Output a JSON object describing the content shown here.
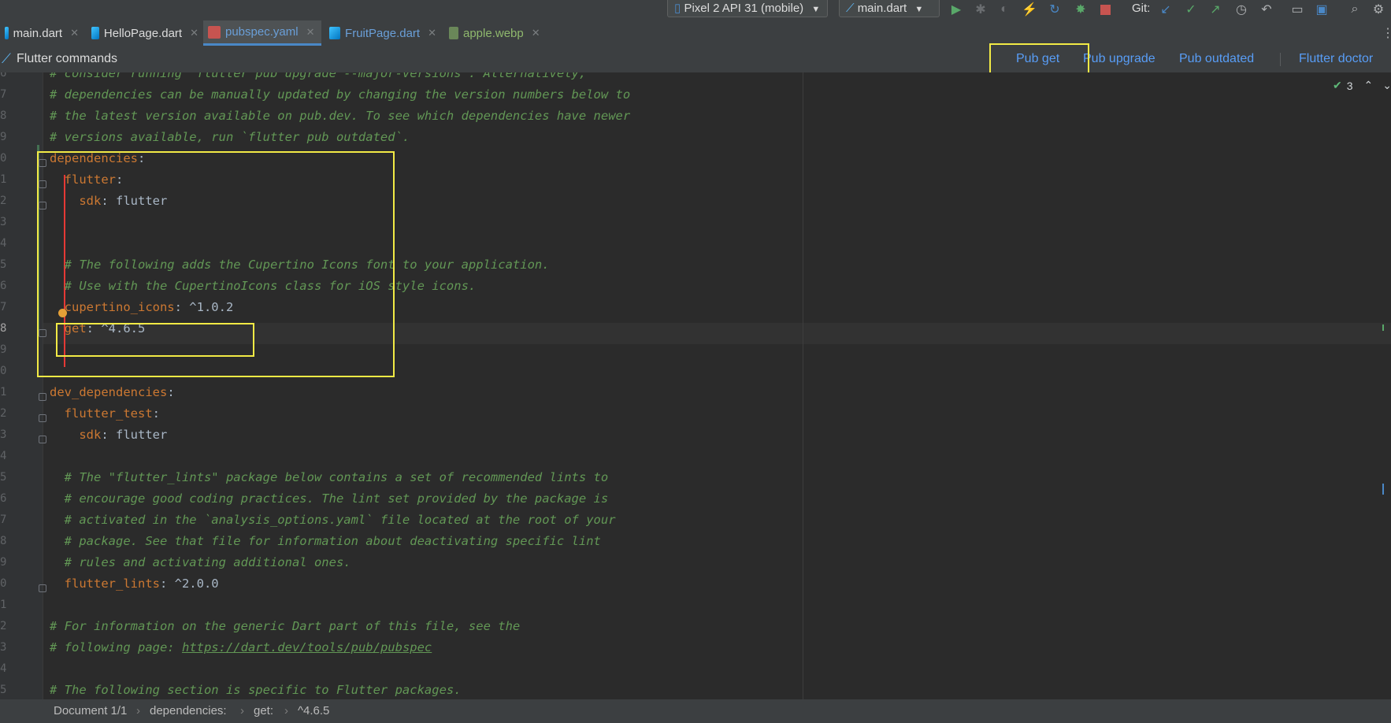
{
  "toolbar": {
    "device": "Pixel 2 API 31 (mobile)",
    "run_config": "main.dart",
    "git_label": "Git:",
    "icons": [
      "run-icon",
      "debug-icon",
      "attach-icon",
      "hot-reload-icon",
      "hot-restart-icon",
      "profile-icon",
      "stop-icon",
      "git-update-icon",
      "git-commit-icon",
      "git-push-icon",
      "history-icon",
      "rollback-icon",
      "device-manager-icon",
      "sdk-manager-icon",
      "search-icon",
      "settings-icon"
    ]
  },
  "tabs": [
    {
      "label": "main.dart",
      "active": false
    },
    {
      "label": "HelloPage.dart",
      "active": false
    },
    {
      "label": "pubspec.yaml",
      "active": true
    },
    {
      "label": "FruitPage.dart",
      "active": false
    },
    {
      "label": "apple.webp",
      "active": false
    }
  ],
  "flutter_commands": {
    "title": "Flutter commands",
    "pub_get": "Pub get",
    "pub_upgrade": "Pub upgrade",
    "pub_outdated": "Pub outdated",
    "flutter_doctor": "Flutter doctor"
  },
  "inspection": {
    "count": "3"
  },
  "editor": {
    "line_numbers": [
      "6",
      "7",
      "8",
      "9",
      "0",
      "1",
      "2",
      "3",
      "4",
      "5",
      "6",
      "7",
      "8",
      "9",
      "0",
      "1",
      "2",
      "3",
      "4",
      "5",
      "6",
      "7",
      "8",
      "9",
      "0",
      "1",
      "2",
      "3",
      "4",
      "5"
    ],
    "lines": [
      [
        {
          "t": "# consider running `flutter pub upgrade --major-versions`. Alternatively,",
          "c": "cm"
        }
      ],
      [
        {
          "t": "# dependencies can be manually updated by changing the version numbers below to",
          "c": "cm"
        }
      ],
      [
        {
          "t": "# the latest version available on pub.dev. To see which dependencies have newer",
          "c": "cm"
        }
      ],
      [
        {
          "t": "# versions available, run `flutter pub outdated`.",
          "c": "cm"
        }
      ],
      [
        {
          "t": "dependencies",
          "c": "key"
        },
        {
          "t": ":",
          "c": "val"
        }
      ],
      [
        {
          "t": "  flutter",
          "c": "key"
        },
        {
          "t": ":",
          "c": "val"
        }
      ],
      [
        {
          "t": "    sdk",
          "c": "key"
        },
        {
          "t": ": flutter",
          "c": "val"
        }
      ],
      [],
      [],
      [
        {
          "t": "  # The following adds the Cupertino Icons font to your application.",
          "c": "cm"
        }
      ],
      [
        {
          "t": "  # Use with the CupertinoIcons class for iOS style icons.",
          "c": "cm"
        }
      ],
      [
        {
          "t": "  cupertino_icons",
          "c": "key"
        },
        {
          "t": ": ^1.0.2",
          "c": "val"
        }
      ],
      [
        {
          "t": "  get",
          "c": "key"
        },
        {
          "t": ": ^4.6.5",
          "c": "val"
        }
      ],
      [],
      [],
      [
        {
          "t": "dev_dependencies",
          "c": "key"
        },
        {
          "t": ":",
          "c": "val"
        }
      ],
      [
        {
          "t": "  flutter_test",
          "c": "key"
        },
        {
          "t": ":",
          "c": "val"
        }
      ],
      [
        {
          "t": "    sdk",
          "c": "key"
        },
        {
          "t": ": flutter",
          "c": "val"
        }
      ],
      [],
      [
        {
          "t": "  # The \"flutter_lints\" package below contains a set of recommended lints to",
          "c": "cm"
        }
      ],
      [
        {
          "t": "  # encourage good coding practices. The lint set provided by the package is",
          "c": "cm"
        }
      ],
      [
        {
          "t": "  # activated in the `analysis_options.yaml` file located at the root of your",
          "c": "cm"
        }
      ],
      [
        {
          "t": "  # package. See that file for information about deactivating specific lint",
          "c": "cm"
        }
      ],
      [
        {
          "t": "  # rules and activating additional ones.",
          "c": "cm"
        }
      ],
      [
        {
          "t": "  flutter_lints",
          "c": "key"
        },
        {
          "t": ": ^2.0.0",
          "c": "val"
        }
      ],
      [],
      [
        {
          "t": "# For information on the generic Dart part of this file, see the",
          "c": "cm"
        }
      ],
      [
        {
          "t": "# following page: ",
          "c": "cm"
        },
        {
          "t": "https://dart.dev/tools/pub/pubspec",
          "c": "url"
        }
      ],
      [],
      [
        {
          "t": "# The following section is specific to Flutter packages.",
          "c": "cm"
        }
      ]
    ]
  },
  "statusbar": {
    "crumbs": [
      "Document 1/1",
      "dependencies:",
      "get:",
      "^4.6.5"
    ]
  },
  "colors": {
    "highlight": "#f2ea45",
    "link": "#589df6",
    "comment": "#629755",
    "key": "#cc7832"
  }
}
